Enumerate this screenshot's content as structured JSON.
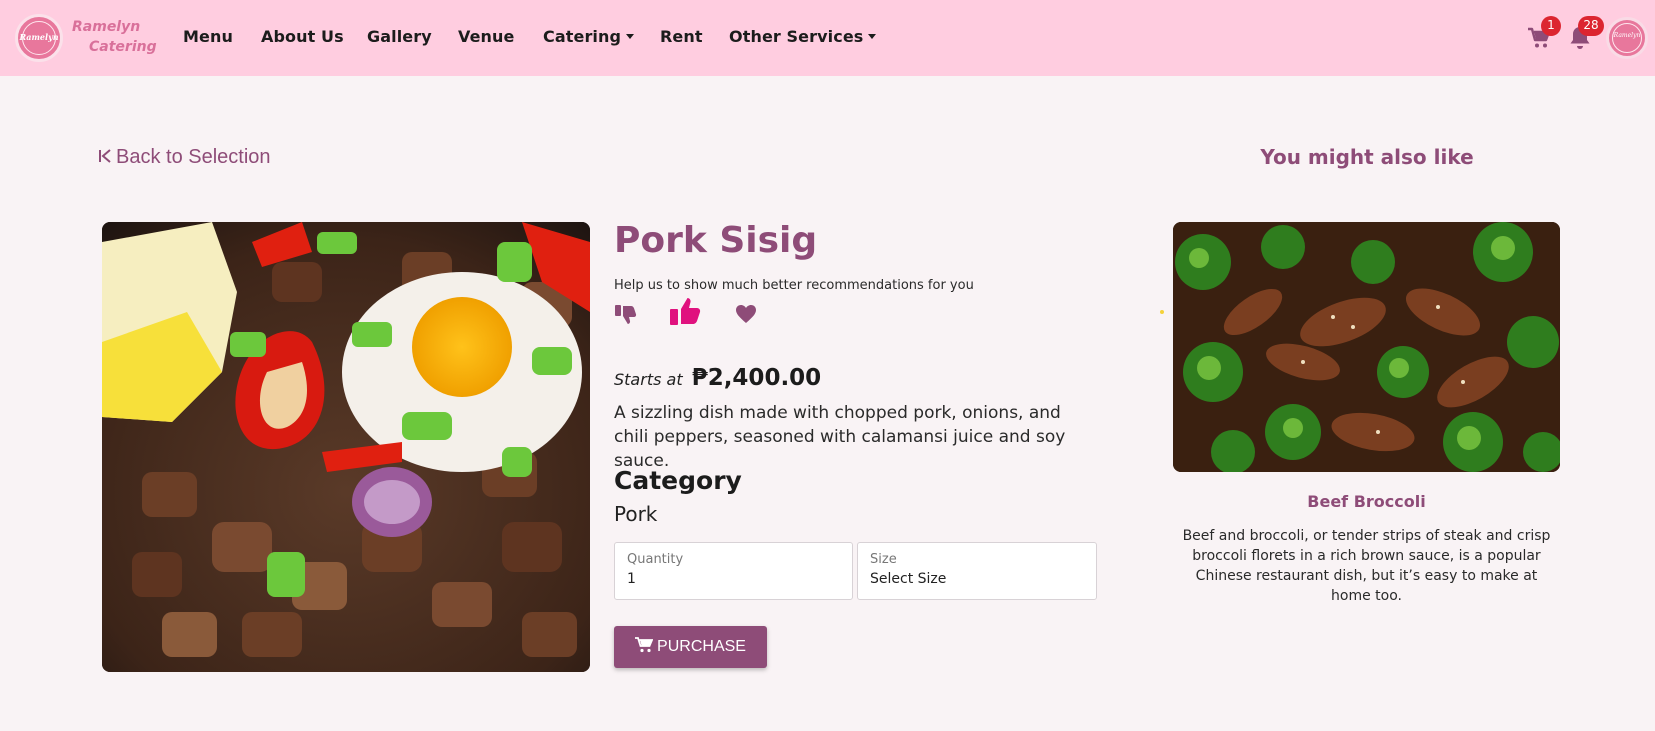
{
  "brand": {
    "logo_text": "Ramelyn",
    "name_line1": "Ramelyn",
    "name_line2": "Catering"
  },
  "nav": {
    "menu": "Menu",
    "about": "About Us",
    "gallery": "Gallery",
    "venue": "Venue",
    "catering": "Catering",
    "rent": "Rent",
    "other": "Other Services"
  },
  "header_icons": {
    "cart_icon": "cart-icon",
    "bell_icon": "bell-icon",
    "cart_count": "1",
    "notif_count": "28",
    "avatar_text": "Ramelyn"
  },
  "back_label": "Back to Selection",
  "also_like_heading": "You might also like",
  "product": {
    "name": "Pork Sisig",
    "help_text": "Help us to show much better recommendations for you",
    "price_label": "Starts at",
    "price": "₱2,400.00",
    "description": "A sizzling dish made with chopped pork, onions, and chili peppers, seasoned with calamansi juice and soy sauce.",
    "category_heading": "Category",
    "category": "Pork",
    "quantity_label": "Quantity",
    "quantity_value": "1",
    "size_label": "Size",
    "size_value": "Select Size",
    "purchase_label": "PURCHASE"
  },
  "feedback_icons": [
    "thumbs-down-icon",
    "thumbs-up-icon",
    "heart-icon"
  ],
  "recommendation": {
    "name": "Beef Broccoli",
    "description": "Beef and broccoli, or tender strips of steak and crisp broccoli florets in a rich brown sauce, is a popular Chinese restaurant dish, but it’s easy to make at home too."
  },
  "colors": {
    "navbar": "#ffcde0",
    "accent": "#8e4c78",
    "thumbs_up_active": "#e0117e",
    "badge": "#dc2530",
    "background": "#f9f3f5"
  }
}
